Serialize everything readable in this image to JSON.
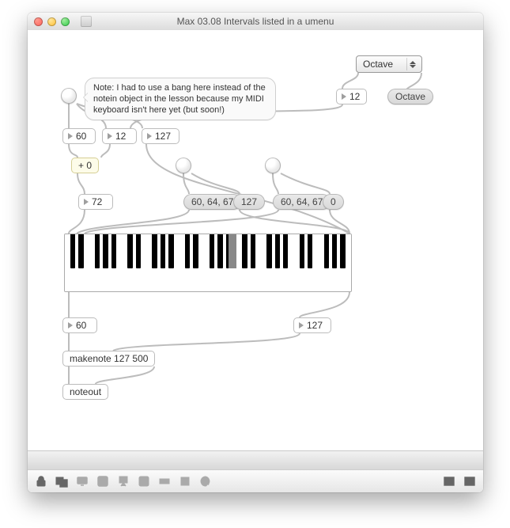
{
  "titlebar": {
    "title": "Max 03.08 Intervals listed in a umenu"
  },
  "umenu": {
    "selected": "Octave",
    "pill_label": "Octave",
    "value": "12"
  },
  "comment": "Note: I had to use a bang here instead of the notein object in the lesson because my MIDI keyboard isn't here yet (but soon!)",
  "row1": {
    "n60": "60",
    "n12": "12",
    "n127": "127"
  },
  "add": {
    "label": "+ 0"
  },
  "n72": "72",
  "chord1": {
    "msg": "60, 64, 67",
    "vel": "127"
  },
  "chord2": {
    "msg": "60, 64, 67",
    "vel": "0"
  },
  "out": {
    "n60": "60",
    "n127": "127"
  },
  "makenote": "makenote 127 500",
  "noteout": "noteout"
}
